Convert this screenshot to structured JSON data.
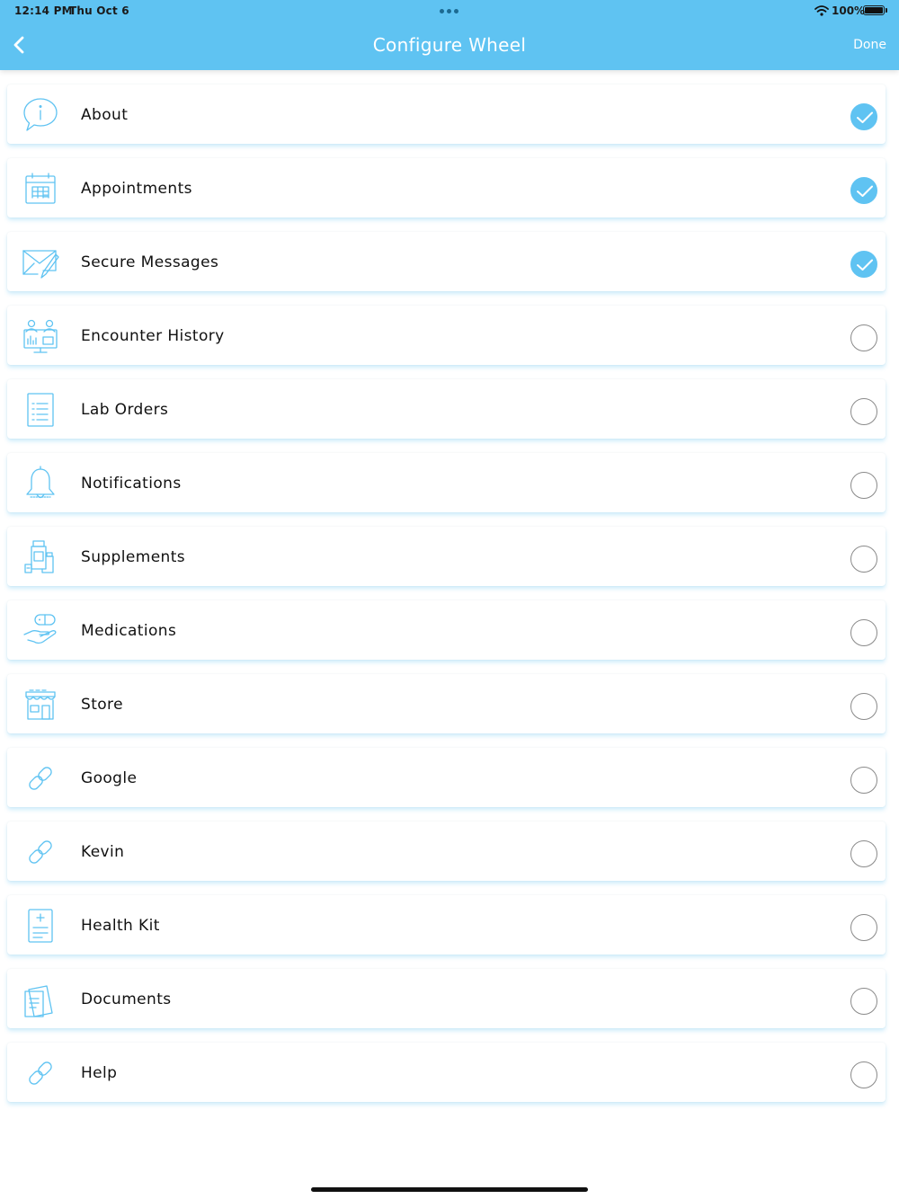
{
  "status_bar": {
    "time": "12:14 PM",
    "date": "Thu Oct 6",
    "battery_percent": "100%"
  },
  "nav": {
    "title": "Configure Wheel",
    "done_label": "Done"
  },
  "colors": {
    "accent": "#5fc3f2",
    "icon_stroke": "#5fc3f2",
    "text": "#111111"
  },
  "items": [
    {
      "label": "About",
      "icon": "info-bubble-icon",
      "checked": true
    },
    {
      "label": "Appointments",
      "icon": "calendar-icon",
      "checked": true
    },
    {
      "label": "Secure Messages",
      "icon": "envelope-pencil-icon",
      "checked": true
    },
    {
      "label": "Encounter History",
      "icon": "monitor-doctors-icon",
      "checked": false
    },
    {
      "label": "Lab Orders",
      "icon": "clipboard-list-icon",
      "checked": false
    },
    {
      "label": "Notifications",
      "icon": "bell-icon",
      "checked": false
    },
    {
      "label": "Supplements",
      "icon": "bottles-icon",
      "checked": false
    },
    {
      "label": "Medications",
      "icon": "hand-pill-icon",
      "checked": false
    },
    {
      "label": "Store",
      "icon": "storefront-icon",
      "checked": false
    },
    {
      "label": "Google",
      "icon": "link-icon",
      "checked": false
    },
    {
      "label": "Kevin",
      "icon": "link-icon",
      "checked": false
    },
    {
      "label": "Health Kit",
      "icon": "medical-document-icon",
      "checked": false
    },
    {
      "label": "Documents",
      "icon": "documents-icon",
      "checked": false
    },
    {
      "label": "Help",
      "icon": "link-icon",
      "checked": false
    }
  ]
}
